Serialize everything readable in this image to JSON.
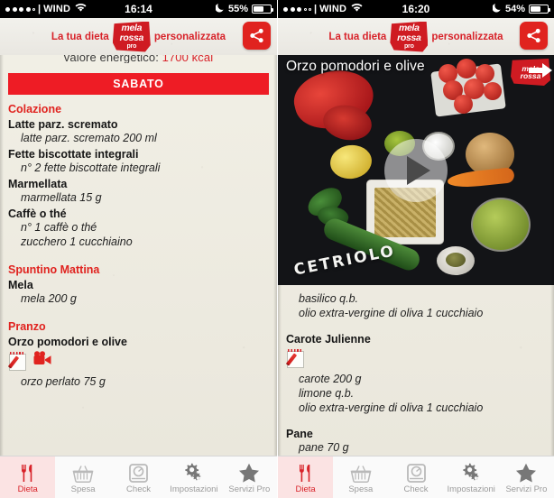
{
  "screens": [
    {
      "id": "diet-plan",
      "status_bar": {
        "signal_dots_filled": 4,
        "signal_dots_empty": 1,
        "separator": "|",
        "carrier": "WIND",
        "wifi_icon": "wifi-icon",
        "time": "16:14",
        "dnd_icon": "moon-icon",
        "battery_percent": "55%",
        "battery_level": 55
      },
      "header": {
        "text_before": "La tua dieta",
        "logo_line1": "mela",
        "logo_line2": "rossa",
        "logo_line3": "pro",
        "text_after": "personalizzata",
        "share_icon": "share-icon"
      },
      "clipped_header_text": "valore energetico:",
      "clipped_header_kcal": "1700 kcal",
      "day_banner": "SABATO",
      "meals": [
        {
          "title": "Colazione",
          "items": [
            {
              "name": "Latte parz. scremato",
              "details": [
                "latte parz. scremato 200 ml"
              ],
              "icons": []
            },
            {
              "name": "Fette biscottate integrali",
              "details": [
                "n° 2 fette biscottate integrali"
              ],
              "icons": []
            },
            {
              "name": "Marmellata",
              "details": [
                "marmellata 15 g"
              ],
              "icons": []
            },
            {
              "name": "Caffè o thé",
              "details": [
                "n° 1 caffè o thé",
                "zucchero 1 cucchiaino"
              ],
              "icons": []
            }
          ]
        },
        {
          "title": "Spuntino Mattina",
          "items": [
            {
              "name": "Mela",
              "details": [
                "mela 200 g"
              ],
              "icons": []
            }
          ]
        },
        {
          "title": "Pranzo",
          "items": [
            {
              "name": "Orzo pomodori e olive",
              "details": [
                "orzo perlato 75 g"
              ],
              "icons": [
                "recipe-note-icon",
                "video-camera-icon"
              ]
            }
          ]
        }
      ]
    },
    {
      "id": "recipe-video",
      "status_bar": {
        "signal_dots_filled": 3,
        "signal_dots_empty": 2,
        "separator": "|",
        "carrier": "WIND",
        "wifi_icon": "wifi-icon",
        "time": "16:20",
        "dnd_icon": "moon-icon",
        "battery_percent": "54%",
        "battery_level": 54
      },
      "header": {
        "text_before": "La tua dieta",
        "logo_line1": "mela",
        "logo_line2": "rossa",
        "logo_line3": "pro",
        "text_after": "personalizzata",
        "share_icon": "share-icon"
      },
      "video": {
        "title": "Orzo pomodori e olive",
        "badge_line1": "mela",
        "badge_line2": "rossa",
        "overlay_label": "CETRIOLO",
        "play_icon": "play-button-icon"
      },
      "recipe_continued": [
        "basilico q.b.",
        "olio extra-vergine di oliva 1 cucchiaio"
      ],
      "items": [
        {
          "name": "Carote Julienne",
          "icons": [
            "recipe-note-icon"
          ],
          "details": [
            "carote 200 g",
            "limone q.b.",
            "olio extra-vergine di oliva 1 cucchiaio"
          ]
        },
        {
          "name": "Pane",
          "icons": [],
          "details": [
            "pane 70 g"
          ]
        }
      ]
    }
  ],
  "tabbar": {
    "tabs": [
      {
        "label": "Dieta",
        "icon": "cutlery-icon",
        "active": true
      },
      {
        "label": "Spesa",
        "icon": "shopping-basket-icon",
        "active": false
      },
      {
        "label": "Check",
        "icon": "scale-icon",
        "active": false
      },
      {
        "label": "Impostazioni",
        "icon": "gears-icon",
        "active": false
      },
      {
        "label": "Servizi Pro",
        "icon": "star-icon",
        "active": false
      }
    ]
  },
  "colors": {
    "brand_red": "#d8232a",
    "banner_red": "#ee1c25",
    "paper": "#eeece1",
    "tab_active_bg": "#fbe3e3",
    "tab_inactive_text": "#9b9b9b"
  }
}
